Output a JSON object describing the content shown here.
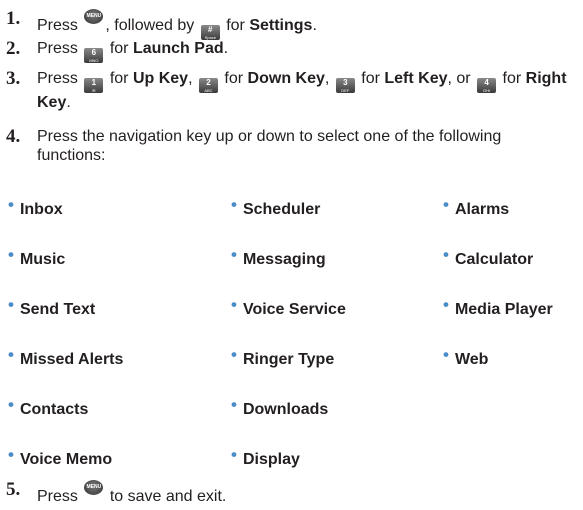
{
  "steps": [
    {
      "number": "1.",
      "parts": {
        "press": "Press",
        "key_a_label": "MENU OK",
        "mid": ", followed by",
        "key_b_label": "#",
        "key_b_sub": "Space",
        "for": "for",
        "target": "Settings",
        "end": "."
      }
    },
    {
      "number": "2.",
      "parts": {
        "press": "Press",
        "key_label": "6",
        "key_sub": "MNO",
        "for": "for",
        "target": "Launch Pad",
        "end": "."
      }
    },
    {
      "number": "3.",
      "parts": {
        "press": "Press",
        "key1_label": "1",
        "key1_sub": "✉",
        "for1": "for",
        "target1": "Up Key",
        "sep1": ",",
        "key2_label": "2",
        "key2_sub": "ABC",
        "for2": "for",
        "target2": "Down Key",
        "sep2": ",",
        "key3_label": "3",
        "key3_sub": "DEF",
        "for3": "for",
        "target3": "Left Key",
        "or": ", or",
        "key4_label": "4",
        "key4_sub": "GHI",
        "for4": "for",
        "target4": "Right Key",
        "end": "."
      }
    },
    {
      "number": "4.",
      "text": "Press the navigation key up or down to select one of the following functions:"
    },
    {
      "number": "5.",
      "parts": {
        "press": "Press",
        "key_label": "MENU OK",
        "rest": "to save and exit."
      }
    }
  ],
  "functions": [
    [
      "Inbox",
      "Scheduler",
      "Alarms"
    ],
    [
      "Music",
      "Messaging",
      "Calculator"
    ],
    [
      "Send Text",
      "Voice Service",
      "Media Player"
    ],
    [
      "Missed Alerts",
      "Ringer Type",
      "Web"
    ],
    [
      "Contacts",
      "Downloads",
      ""
    ],
    [
      "Voice Memo",
      "Display",
      ""
    ]
  ],
  "colors": {
    "text": "#231f20",
    "bullet": "#4a8cc8",
    "key": "#3a3a3a"
  }
}
